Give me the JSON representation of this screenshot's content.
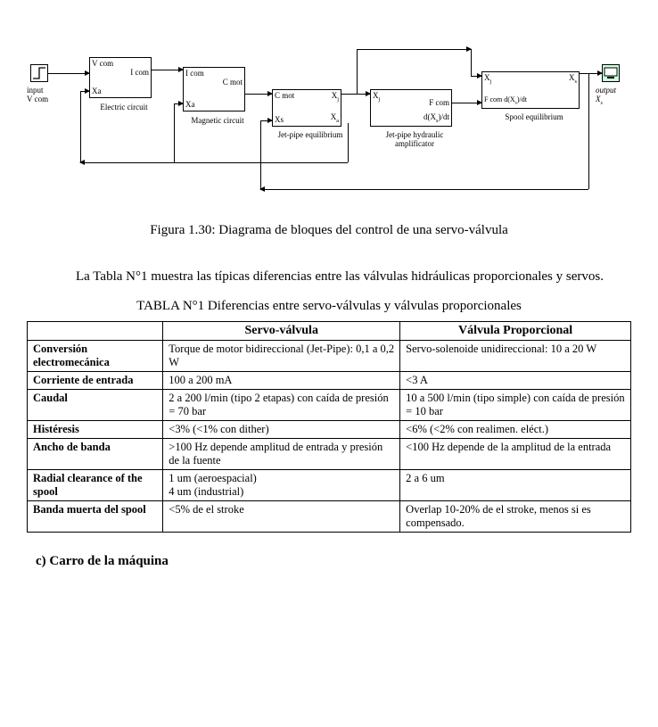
{
  "diagram": {
    "input_block": "input\nV com",
    "output_block": "output\nXs",
    "blocks": [
      {
        "id": "elec",
        "name": "Electric circuit",
        "inputs": [
          "V com",
          "Xa"
        ],
        "outputs": [
          "I com"
        ]
      },
      {
        "id": "mag",
        "name": "Magnetic circuit",
        "inputs": [
          "I com",
          "Xa"
        ],
        "outputs": [
          "C mot"
        ]
      },
      {
        "id": "jet",
        "name": "Jet-pipe equilibrium",
        "inputs": [
          "C mot",
          "Xs"
        ],
        "outputs": [
          "Xj",
          "Xa"
        ]
      },
      {
        "id": "amp",
        "name": "Jet-pipe hydraulic amplificator",
        "inputs": [
          "Xj"
        ],
        "outputs": [
          "F com",
          "d(Xs)/dt"
        ]
      },
      {
        "id": "spool",
        "name": "Spool equilibrium",
        "inputs": [
          "Xj",
          "F com",
          "d(Xs)/dt"
        ],
        "outputs": [
          "Xs"
        ]
      }
    ],
    "sig": {
      "Vcom": "V com",
      "Icom": "I com",
      "Xa": "Xa",
      "Cmot": "C mot",
      "Xj": "Xj",
      "Xs": "Xs",
      "Fcom": "F com",
      "dXs": "d(Xs)/dt"
    }
  },
  "figure_caption": "Figura 1.30: Diagrama de bloques del control de una servo-válvula",
  "paragraph": "La Tabla N°1 muestra las típicas diferencias entre las válvulas hidráulicas proporcionales y servos.",
  "table_title": "TABLA N°1 Diferencias entre servo-válvulas y válvulas proporcionales",
  "table": {
    "head": [
      "",
      "Servo-válvula",
      "Válvula Proporcional"
    ],
    "rows": [
      {
        "h": "Conversión electromecánica",
        "sv": "Torque de motor bidireccional (Jet-Pipe): 0,1 a 0,2 W",
        "vp": "Servo-solenoide unidireccional: 10 a 20 W"
      },
      {
        "h": "Corriente de entrada",
        "sv": "100 a 200 mA",
        "vp": "<3 A"
      },
      {
        "h": "Caudal",
        "sv": "2 a 200 l/min (tipo 2 etapas) con caída de presión = 70 bar",
        "vp": "10 a 500 l/min (tipo simple) con caída de presión = 10 bar"
      },
      {
        "h": "Histéresis",
        "sv": "<3% (<1% con dither)",
        "vp": "<6% (<2% con realimen. eléct.)"
      },
      {
        "h": "Ancho de banda",
        "sv": ">100 Hz depende amplitud de entrada y presión de la fuente",
        "vp": "<100 Hz depende de la amplitud de la entrada"
      },
      {
        "h": "Radial clearance of the spool",
        "sv": "1 um (aeroespacial)\n4 um (industrial)",
        "vp": "2 a 6 um"
      },
      {
        "h": "Banda muerta del spool",
        "sv": "<5% de el stroke",
        "vp": "Overlap 10-20% de el stroke, menos si es compensado."
      }
    ]
  },
  "subheading": "c) Carro de la máquina"
}
